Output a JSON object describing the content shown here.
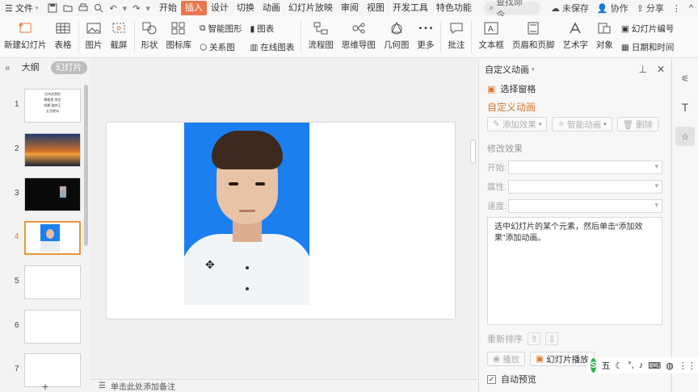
{
  "menubar": {
    "file_label": "文件",
    "tabs": [
      "开始",
      "插入",
      "设计",
      "切换",
      "动画",
      "幻灯片放映",
      "审阅",
      "视图",
      "开发工具",
      "特色功能"
    ],
    "active_tab": "插入",
    "search_placeholder": "查找命令...",
    "unsaved": "未保存",
    "collab": "协作",
    "share": "分享"
  },
  "ribbon": {
    "new_slide": "新建幻灯片",
    "table": "表格",
    "picture": "图片",
    "screenshot": "截屏",
    "shape": "形状",
    "icon_lib": "图标库",
    "smart_graphic": "智能图形",
    "relation": "关系图",
    "chart": "图表",
    "online_chart": "在线图表",
    "flowchart": "流程图",
    "mindmap": "思维导图",
    "geometry": "几何图",
    "more": "更多",
    "comment": "批注",
    "textbox": "文本框",
    "header_footer": "页眉和页脚",
    "wordart": "艺术字",
    "object": "对象",
    "slide_number": "幻灯片编号",
    "date_time": "日期和时间"
  },
  "leftpanel": {
    "tab_outline": "大纲",
    "tab_slides": "幻灯片",
    "slides": [
      "1",
      "2",
      "3",
      "4",
      "5",
      "6",
      "7"
    ],
    "selected": "4",
    "thumb1_lines": [
      "古诗文赏析",
      "静夜思 李白",
      "咏鹅 骆宾王",
      "五言绝句"
    ],
    "add": "+"
  },
  "canvas": {
    "notes_placeholder": "单击此处添加备注"
  },
  "rightpanel": {
    "title": "自定义动画",
    "select_pane": "选择窗格",
    "section_title": "自定义动画",
    "add_effect": "添加效果",
    "smart_anim": "智能动画",
    "delete": "删除",
    "modify_title": "修改效果",
    "start_label": "开始:",
    "prop_label": "属性:",
    "speed_label": "速度:",
    "tip": "选中幻灯片的某个元素，然后单击“添加效果”添加动画。",
    "reorder": "重新排序",
    "play": "播放",
    "slideshow": "幻灯片播放",
    "autopreview": "自动预览"
  },
  "ime": {
    "logo": "S",
    "mode": "五"
  },
  "colors": {
    "accent": "#e8784d",
    "orange_text": "#d9782f",
    "photo_bg": "#1b7ff0"
  }
}
